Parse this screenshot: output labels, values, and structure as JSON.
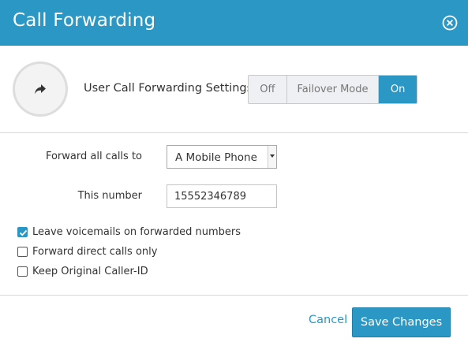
{
  "dialog": {
    "title": "Call Forwarding",
    "close_icon": "close-circle-icon",
    "accent_color": "#2a97c4"
  },
  "settings": {
    "icon": "forward-arrow-icon",
    "label": "User Call Forwarding Settings",
    "toggle": {
      "options": [
        "Off",
        "Failover Mode",
        "On"
      ],
      "selected": "On"
    }
  },
  "form": {
    "forward_label": "Forward all calls to",
    "forward_value": "A Mobile Phone",
    "number_label": "This number",
    "number_value": "15552346789"
  },
  "options": [
    {
      "label": "Leave voicemails on forwarded numbers",
      "checked": true
    },
    {
      "label": "Forward direct calls only",
      "checked": false
    },
    {
      "label": "Keep Original Caller-ID",
      "checked": false
    }
  ],
  "footer": {
    "cancel_label": "Cancel",
    "save_label": "Save Changes"
  }
}
